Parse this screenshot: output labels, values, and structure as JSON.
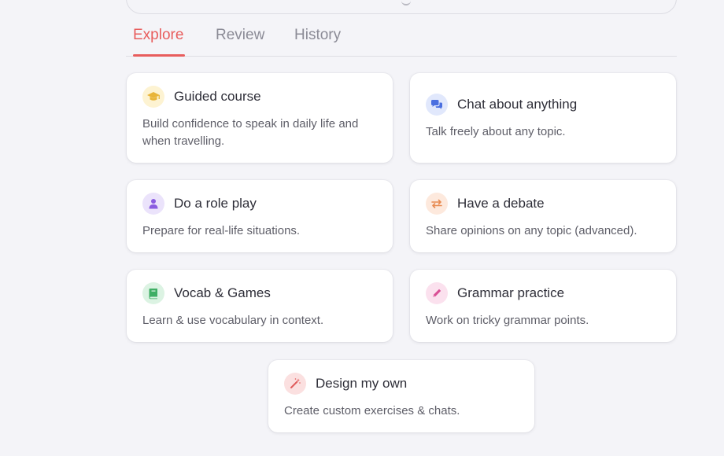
{
  "tabs": {
    "explore": "Explore",
    "review": "Review",
    "history": "History"
  },
  "cards": {
    "guided_course": {
      "title": "Guided course",
      "desc": "Build confidence to speak in daily life and when travelling.",
      "icon": "graduation-cap-icon",
      "icon_bg": "#fdf3d2",
      "icon_color": "#e8b53a"
    },
    "chat": {
      "title": "Chat about anything",
      "desc": "Talk freely about any topic.",
      "icon": "chat-bubbles-icon",
      "icon_bg": "#e1e8fc",
      "icon_color": "#4a6fe0"
    },
    "role_play": {
      "title": "Do a role play",
      "desc": "Prepare for real-life situations.",
      "icon": "person-icon",
      "icon_bg": "#ebe3fb",
      "icon_color": "#8a5ce0"
    },
    "debate": {
      "title": "Have a debate",
      "desc": "Share opinions on any topic (advanced).",
      "icon": "arrows-swap-icon",
      "icon_bg": "#fde9dd",
      "icon_color": "#e88b52"
    },
    "vocab": {
      "title": "Vocab & Games",
      "desc": "Learn & use vocabulary in context.",
      "icon": "book-icon",
      "icon_bg": "#dcf3e3",
      "icon_color": "#3fae65"
    },
    "grammar": {
      "title": "Grammar practice",
      "desc": "Work on tricky grammar points.",
      "icon": "pencil-icon",
      "icon_bg": "#fbe1ee",
      "icon_color": "#d94f95"
    },
    "design": {
      "title": "Design my own",
      "desc": "Create custom exercises & chats.",
      "icon": "magic-wand-icon",
      "icon_bg": "#fbe0e0",
      "icon_color": "#e05c5c"
    }
  },
  "colors": {
    "accent": "#e85d5d",
    "background": "#f4f4f8"
  }
}
